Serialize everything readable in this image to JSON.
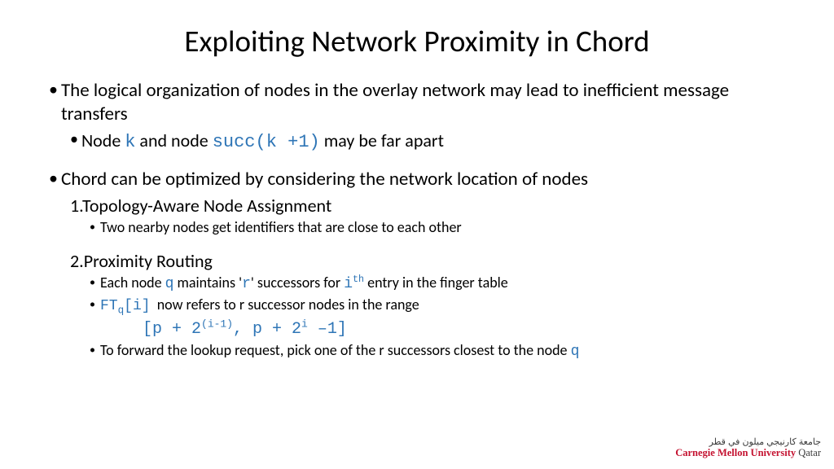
{
  "title": "Exploiting Network Proximity in Chord",
  "b1": {
    "text_pre": "The logical organization of nodes in the overlay network may lead to inefficient message transfers",
    "sub_pre": "Node ",
    "sub_code1": "k",
    "sub_mid": " and node ",
    "sub_code2": "succ(k +1)",
    "sub_post": " may be far apart"
  },
  "b2": {
    "text": "Chord can be optimized by considering the network location of nodes",
    "n1": {
      "label": "1.Topology-Aware Node Assignment",
      "sub": "Two nearby nodes get identifiers that are close to each other"
    },
    "n2": {
      "label": "2.Proximity Routing",
      "s1_pre": "Each node ",
      "s1_c1": "q",
      "s1_mid1": " maintains '",
      "s1_c2": "r",
      "s1_mid2": "' successors for ",
      "s1_c3": "i",
      "s1_sup": "th",
      "s1_post": " entry in the finger table",
      "s2_c1": "FT",
      "s2_sub": "q",
      "s2_c2": "[i]",
      "s2_post": " now refers to r successor nodes in the range",
      "formula_1": "[p + 2",
      "formula_sup1": "(i-1)",
      "formula_2": ", p + 2",
      "formula_sup2": "i",
      "formula_3": " –1]",
      "s3_pre": "To forward the lookup request, pick one of the r successors closest to the node ",
      "s3_c": "q"
    }
  },
  "logo": {
    "arabic": "جامعة كارنيجي ميلون في قطر",
    "en1": "Carnegie Mellon University",
    "en2": " Qatar"
  }
}
